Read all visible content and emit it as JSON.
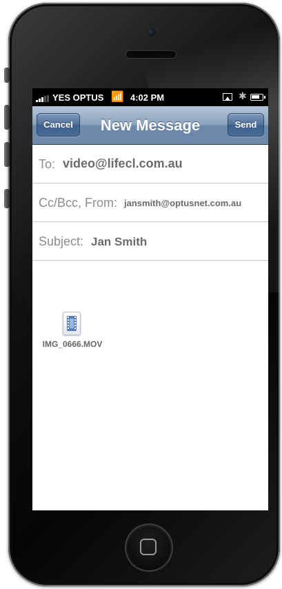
{
  "status_bar": {
    "carrier": "YES OPTUS",
    "time": "4:02 PM"
  },
  "nav": {
    "title": "New Message",
    "cancel_label": "Cancel",
    "send_label": "Send"
  },
  "compose": {
    "to_label": "To:",
    "to_value": "video@lifecl.com.au",
    "ccbcc_label": "Cc/Bcc, From:",
    "from_value": "jansmith@optusnet.com.au",
    "subject_label": "Subject:",
    "subject_value": "Jan Smith"
  },
  "attachment": {
    "filename": "IMG_0666.MOV"
  },
  "colors": {
    "nav_bar": "#8aa1bd",
    "nav_button": "#4f6f9a",
    "label_text": "#8c8c8c",
    "value_text": "#6b6b6b"
  }
}
